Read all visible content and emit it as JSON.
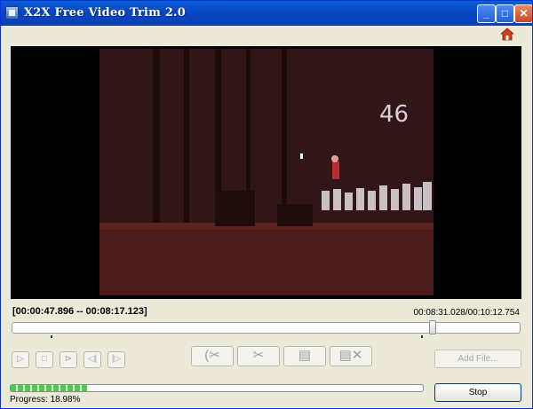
{
  "window": {
    "title": "X2X Free Video Trim 2.0",
    "minimize": "_",
    "maximize": "□",
    "close": "✕"
  },
  "icons": {
    "app": "app-icon",
    "home": "home-icon",
    "home_color": "#d63c1f"
  },
  "video": {
    "overlay_text": "46"
  },
  "trim": {
    "range_label": "[00:00:47.896 -- 00:08:17.123]",
    "position_label": "00:08:31.028/00:10:12.754"
  },
  "playback": {
    "play": "▷",
    "stop": "□",
    "step_forward": "⊳",
    "prev": "◁|",
    "next": "|▷"
  },
  "edit_tools": {
    "cut": "(✂",
    "cut_out": "✂",
    "save_segment": "▤",
    "delete_segment": "▤✕"
  },
  "buttons": {
    "add_file": "Add File...",
    "stop": "Stop"
  },
  "progress": {
    "percent": 18.98,
    "label": "Progress: 18.98%"
  }
}
